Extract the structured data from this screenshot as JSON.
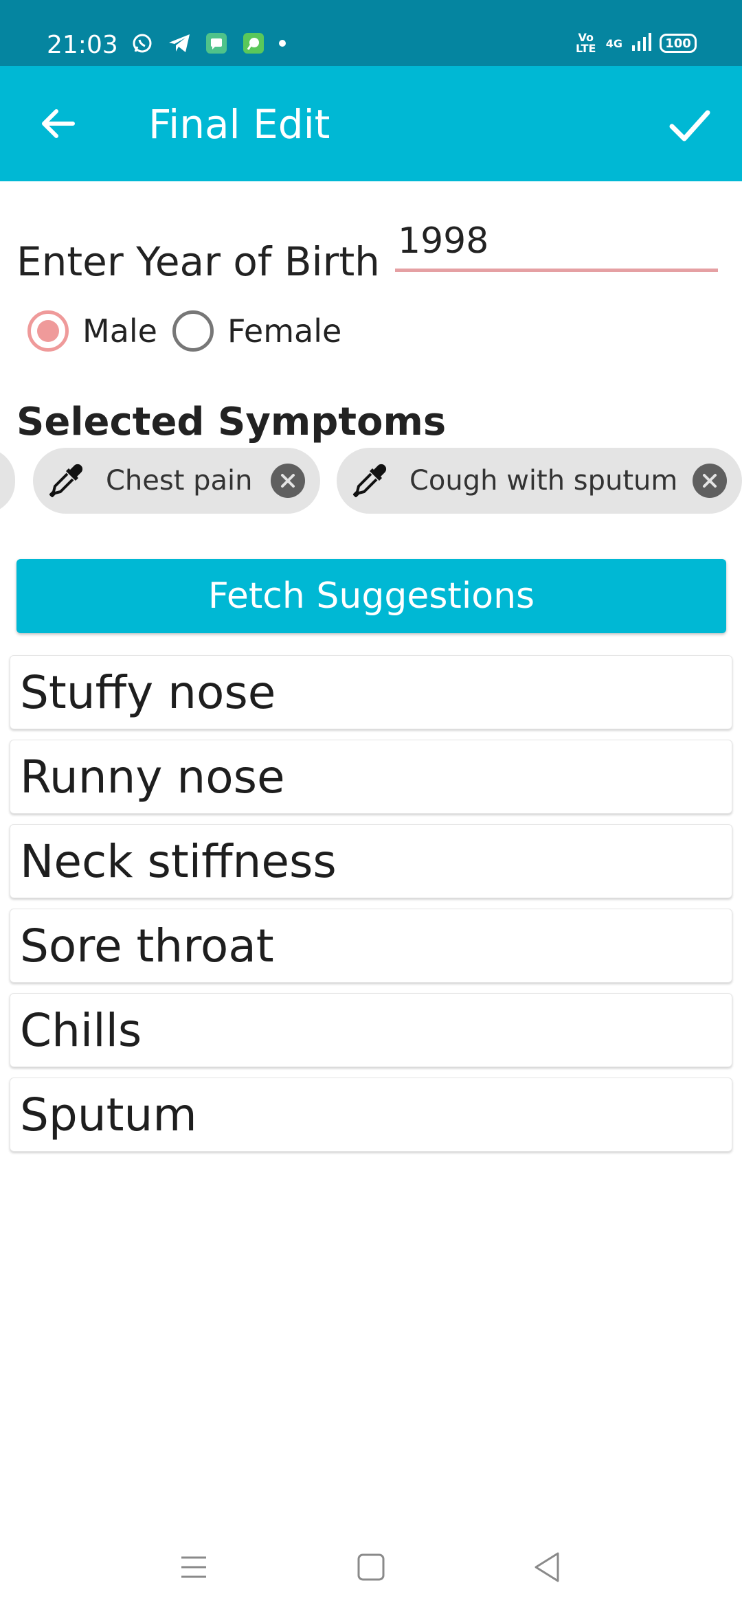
{
  "status_bar": {
    "time": "21:03",
    "left_icons": [
      "whatsapp-icon",
      "telegram-icon",
      "message-icon",
      "app-icon"
    ],
    "volte": "Vo LTE",
    "network": "4G",
    "battery": "100"
  },
  "app_bar": {
    "title": "Final Edit",
    "back_icon": "arrow-back-icon",
    "confirm_icon": "check-icon",
    "color": "#00b8d4"
  },
  "form": {
    "year_of_birth_label": "Enter Year of Birth",
    "year_of_birth_value": "1998",
    "gender_options": [
      {
        "label": "Male",
        "selected": true
      },
      {
        "label": "Female",
        "selected": false
      }
    ]
  },
  "symptoms": {
    "title": "Selected Symptoms",
    "chips": [
      {
        "label": "Chest pain",
        "icon": "eyedropper-icon"
      },
      {
        "label": "Cough with sputum",
        "icon": "eyedropper-icon"
      }
    ]
  },
  "fetch_button": {
    "label": "Fetch Suggestions"
  },
  "suggestions": [
    "Stuffy nose",
    "Runny nose",
    "Neck stiffness",
    "Sore throat",
    "Chills",
    "Sputum"
  ],
  "nav_bar": {
    "buttons": [
      "menu-icon",
      "home-icon",
      "back-triangle-icon"
    ]
  }
}
